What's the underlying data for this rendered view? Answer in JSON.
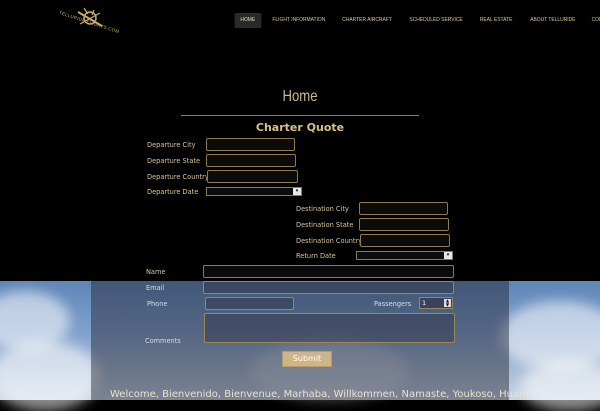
{
  "logo": {
    "text": "TELLURIDE FLIGHTS.COM"
  },
  "nav": {
    "items": [
      "HOME",
      "FLIGHT INFORMATION",
      "CHARTER AIRCRAFT",
      "SCHEDULED SERVICE",
      "REAL ESTATE",
      "ABOUT TELLURIDE",
      "CONTACT"
    ],
    "active": "HOME"
  },
  "page": {
    "title": "Home"
  },
  "form": {
    "title": "Charter Quote",
    "labels": {
      "departure_city": "Departure City",
      "departure_state": "Departure State",
      "departure_country": "Departure Country",
      "departure_date": "Departure Date",
      "destination_city": "Destination City",
      "destination_state": "Destination State",
      "destination_country": "Destination Country",
      "return_date": "Return Date",
      "name": "Name",
      "email": "Email",
      "phone": "Phone",
      "passengers": "Passengers",
      "comments": "Comments"
    },
    "passengers_value": "1",
    "submit_label": "Submit"
  },
  "welcome": "Welcome, Bienvenido, Bienvenue, Marhaba, Willkommen, Namaste, Youkoso, Huan-",
  "colors": {
    "accent": "#cdb587",
    "background": "#000000",
    "input_border": "#8e7a4c"
  }
}
